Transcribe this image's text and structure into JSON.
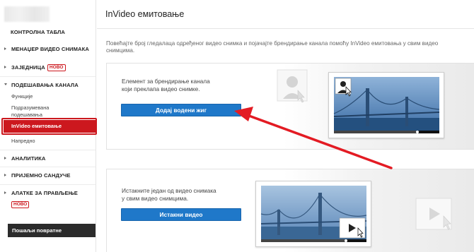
{
  "sidebar": {
    "items": [
      {
        "label": "КОНТРОЛНА ТАБЛА"
      },
      {
        "label": "МЕНАЏЕР ВИДЕО СНИМАКА"
      },
      {
        "label": "ЗАЈЕДНИЦА",
        "badge": "НОВО"
      },
      {
        "label": "ПОДЕШАВАЊА КАНАЛА"
      },
      {
        "label": "АНАЛИТИКА"
      },
      {
        "label": "ПРИЈЕМНО САНДУЧЕ"
      },
      {
        "label": "АЛАТКЕ ЗА ПРАВЉЕЊЕ",
        "badge": "НОВО"
      }
    ],
    "subitems": {
      "functions": "Функције",
      "default_1": "Подразумевана",
      "default_2": "подешавања",
      "invideo": "InVideo емитовање",
      "advanced": "Напредно"
    },
    "feedback": "Пошаљи повратне информације"
  },
  "header": {
    "title": "InVideo емитовање"
  },
  "description": {
    "line1": "Повећајте број гледалаца одређеног видео снимка и појачајте брендирање канала помоћу InVideo емитовања у свим видео",
    "line2": "снимцима."
  },
  "card1": {
    "text_line1": "Елемент за брендирање канала",
    "text_line2": "који преклапа видео снимке.",
    "button": "Додај водени жиг"
  },
  "card2": {
    "text_line1": "Истакните један од видео снимака",
    "text_line2": "у свим видео снимцима.",
    "button": "Истакни видео"
  },
  "colors": {
    "accent_red": "#cc181e",
    "button_blue": "#1f78c9",
    "annotation_red": "#e31b23"
  },
  "icons": [
    "avatar-icon",
    "cursor-icon",
    "play-icon",
    "bridge-thumbnail"
  ]
}
